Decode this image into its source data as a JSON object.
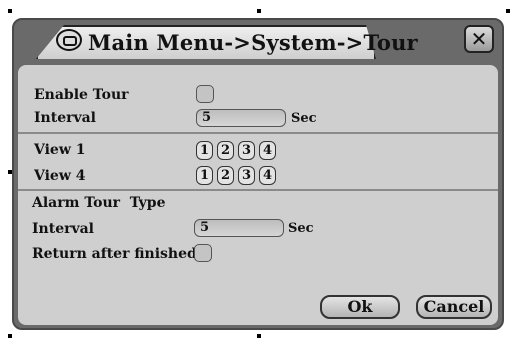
{
  "window": {
    "title": "Main Menu->System->Tour",
    "close_icon": "close-icon"
  },
  "tour": {
    "enable_label": "Enable Tour",
    "enable_checked": false,
    "interval_label": "Interval",
    "interval_value": "5",
    "interval_unit": "Sec"
  },
  "views": [
    {
      "label": "View 1",
      "channels": [
        "1",
        "2",
        "3",
        "4"
      ]
    },
    {
      "label": "View 4",
      "channels": [
        "1",
        "2",
        "3",
        "4"
      ]
    }
  ],
  "alarm_tour": {
    "section_label": "Alarm Tour  Type",
    "interval_label": "Interval",
    "interval_value": "5",
    "interval_unit": "Sec",
    "return_label": "Return after finished",
    "return_checked": false
  },
  "buttons": {
    "ok_label": "Ok",
    "cancel_label": "Cancel"
  }
}
